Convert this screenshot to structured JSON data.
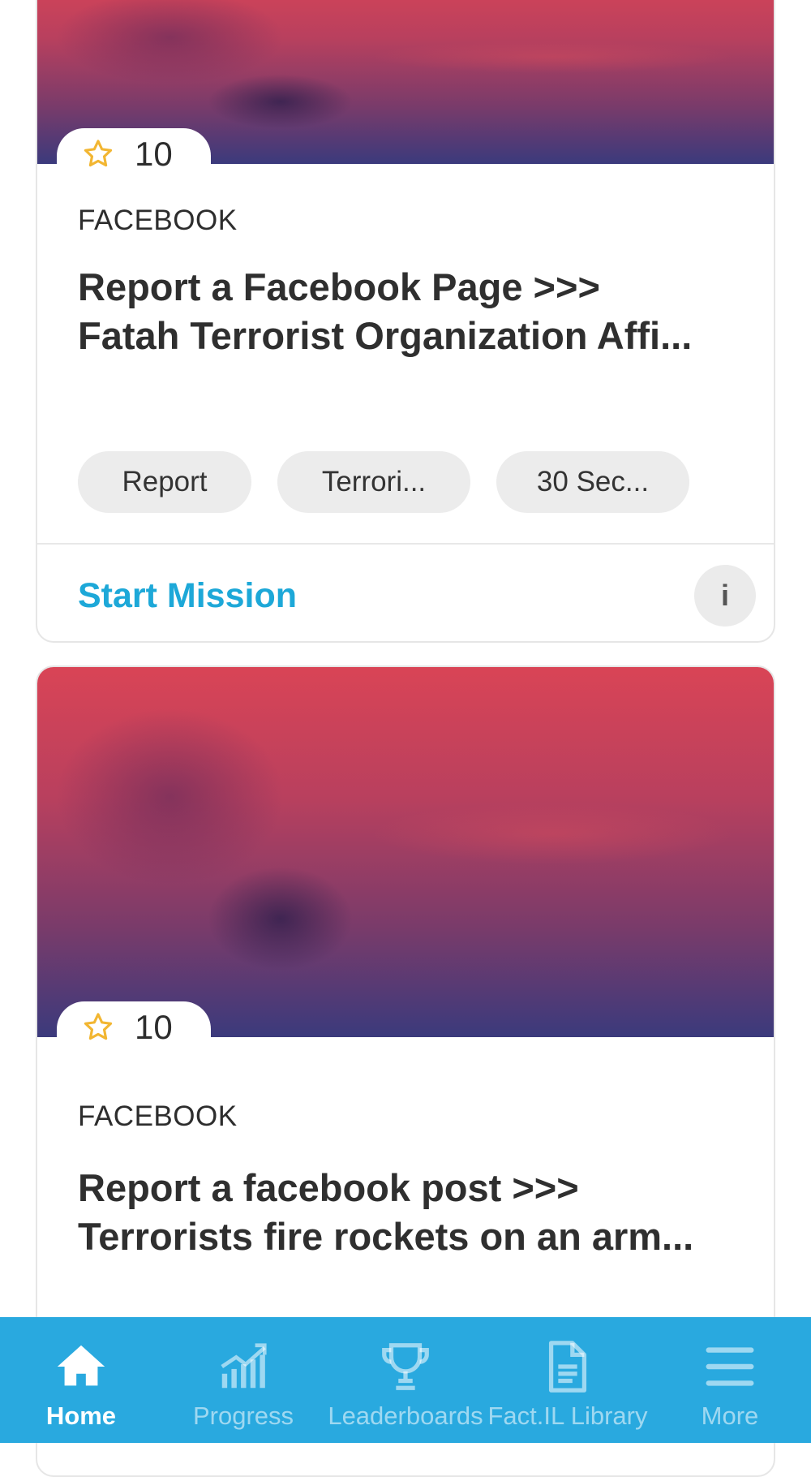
{
  "cards": [
    {
      "points": "10",
      "category": "FACEBOOK",
      "title_lines": [
        "Report a Facebook Page >>>",
        "Fatah Terrorist Organization Affi..."
      ],
      "tags": [
        "Report",
        "Terrori...",
        "30 Sec..."
      ],
      "action_label": "Start Mission",
      "info_label": "i"
    },
    {
      "points": "10",
      "category": "FACEBOOK",
      "title_lines": [
        "Report a facebook post >>>",
        "Terrorists fire rockets on an arm..."
      ]
    }
  ],
  "tabbar": {
    "tabs": [
      {
        "label": "Home",
        "icon": "home-icon",
        "active": true
      },
      {
        "label": "Progress",
        "icon": "bar-chart-icon",
        "active": false
      },
      {
        "label": "Leaderboards",
        "icon": "trophy-icon",
        "active": false
      },
      {
        "label": "Fact.IL Library",
        "icon": "document-icon",
        "active": false
      },
      {
        "label": "More",
        "icon": "menu-icon",
        "active": false
      }
    ]
  },
  "colors": {
    "accent": "#1da8d8",
    "tabbar": "#29a9df",
    "star": "#f2b632"
  }
}
